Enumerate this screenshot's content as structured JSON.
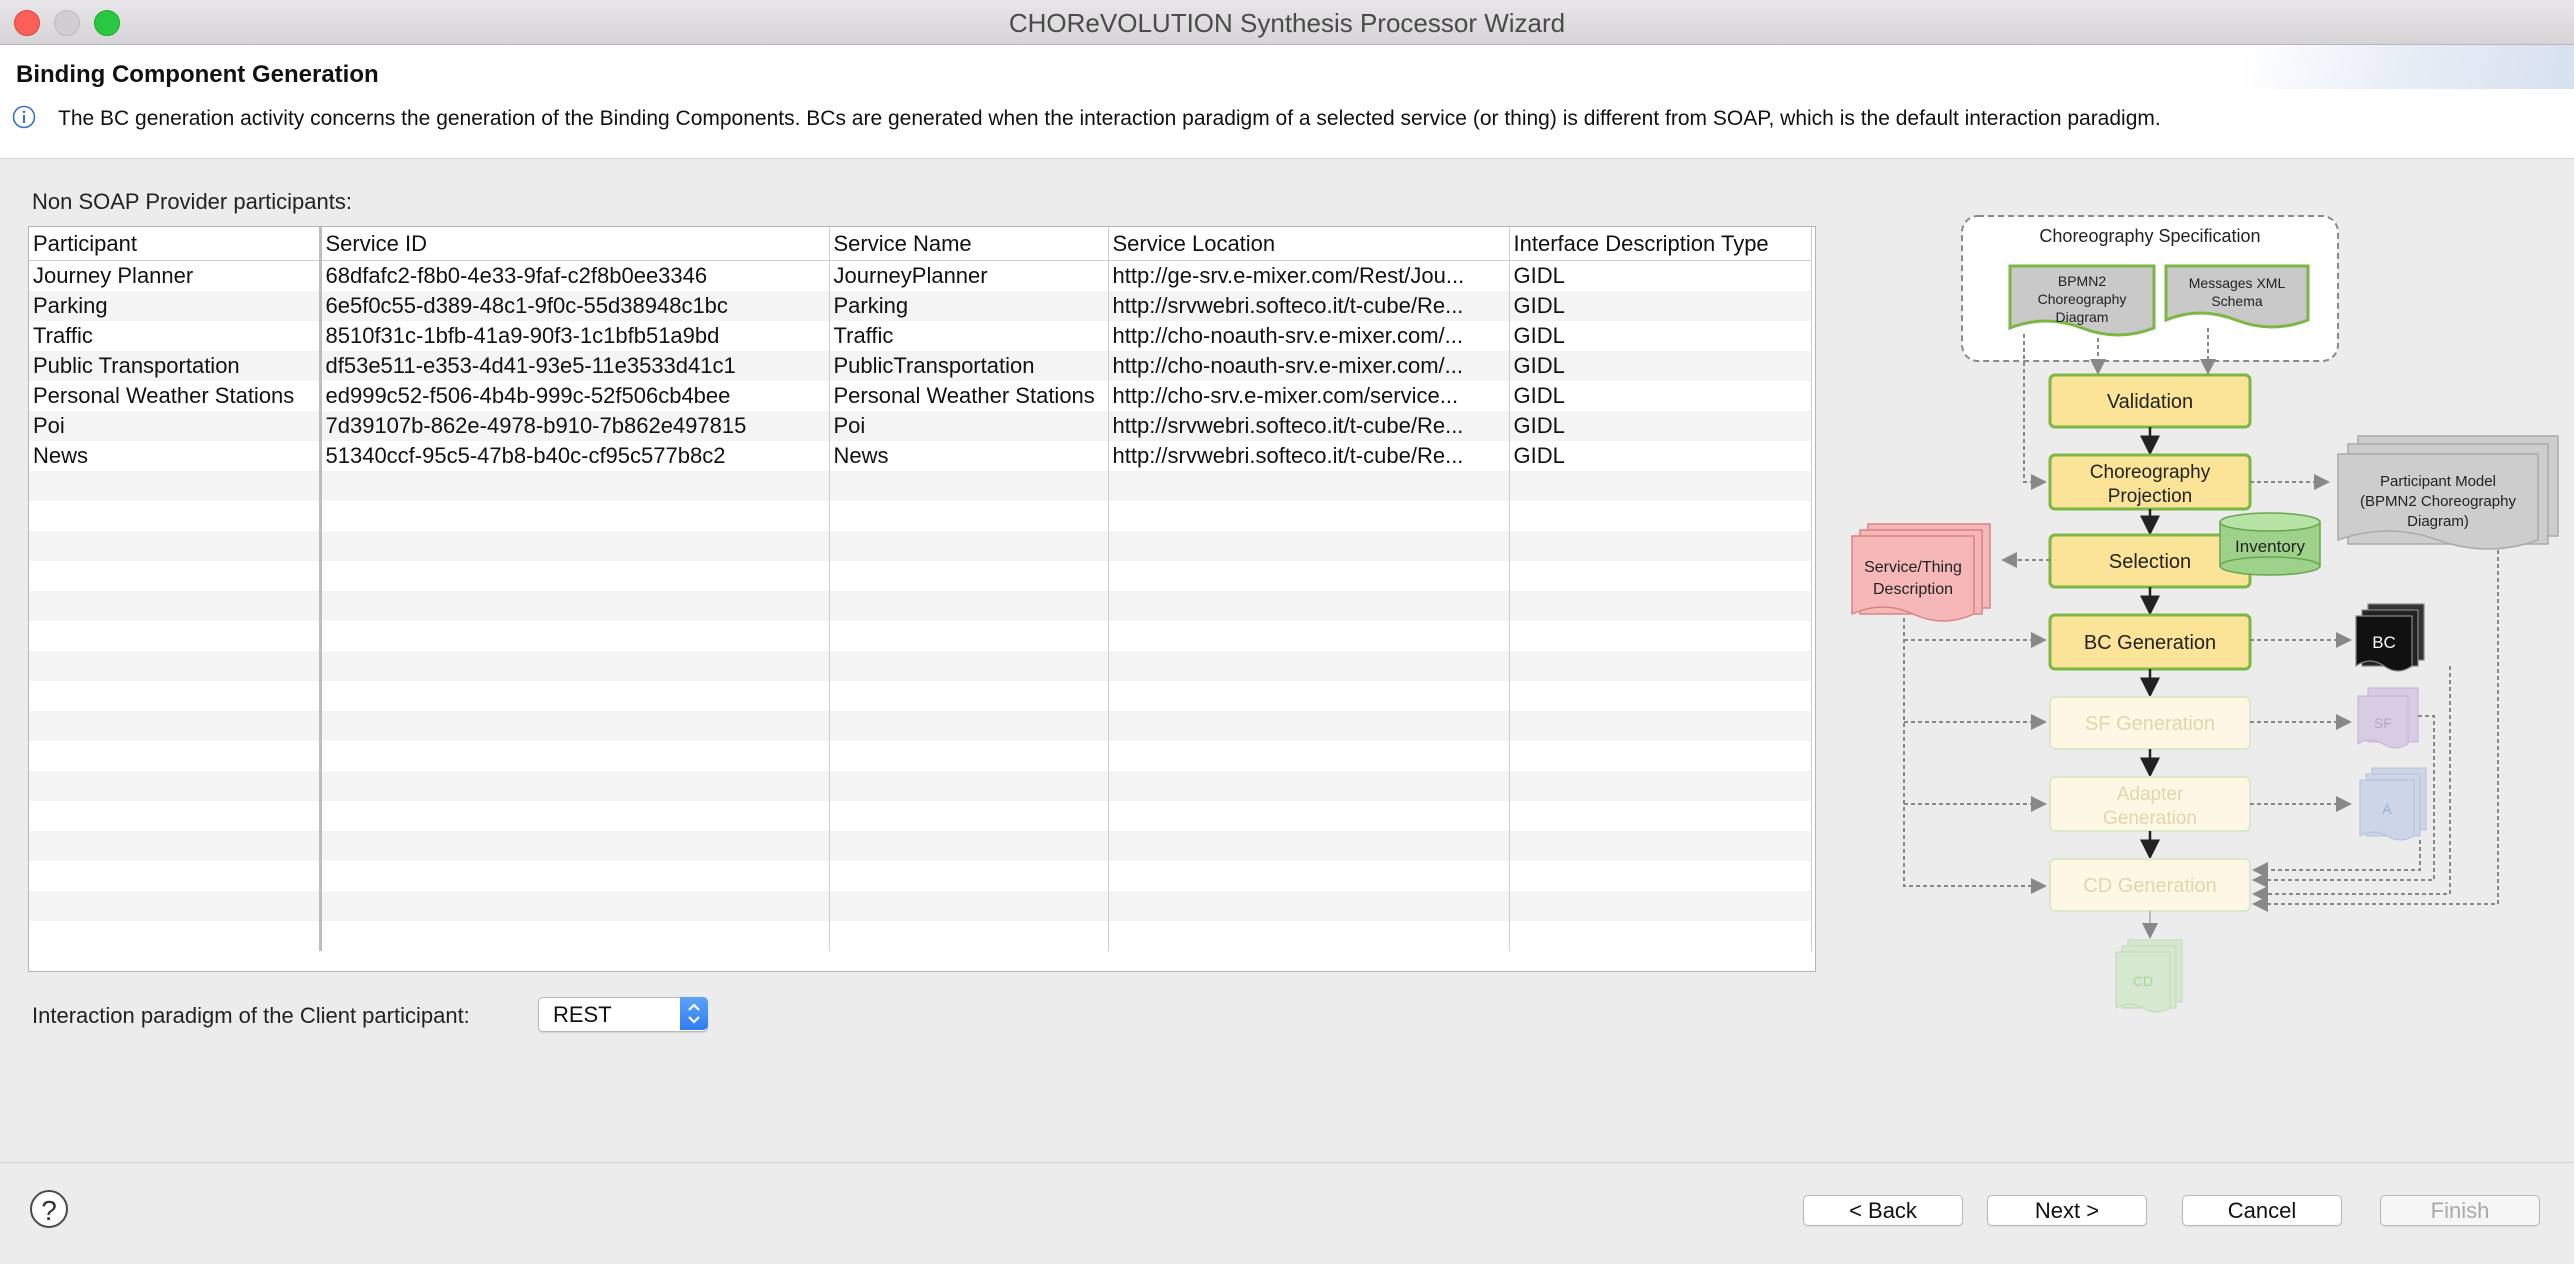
{
  "window": {
    "title": "CHOReVOLUTION Synthesis Processor Wizard"
  },
  "header": {
    "title": "Binding Component Generation",
    "description": "The BC generation activity concerns the generation of the Binding Components. BCs are generated when the interaction paradigm of a selected service (or thing) is different from SOAP, which is the default interaction paradigm."
  },
  "participants": {
    "label": "Non SOAP Provider participants:",
    "columns": [
      "Participant",
      "Service ID",
      "Service Name",
      "Service Location",
      "Interface Description Type"
    ],
    "rows": [
      [
        "Journey Planner",
        "68dfafc2-f8b0-4e33-9faf-c2f8b0ee3346",
        "JourneyPlanner",
        "http://ge-srv.e-mixer.com/Rest/Jou...",
        "GIDL"
      ],
      [
        "Parking",
        "6e5f0c55-d389-48c1-9f0c-55d38948c1bc",
        "Parking",
        "http://srvwebri.softeco.it/t-cube/Re...",
        "GIDL"
      ],
      [
        "Traffic",
        "8510f31c-1bfb-41a9-90f3-1c1bfb51a9bd",
        "Traffic",
        "http://cho-noauth-srv.e-mixer.com/...",
        "GIDL"
      ],
      [
        "Public Transportation",
        "df53e511-e353-4d41-93e5-11e3533d41c1",
        "PublicTransportation",
        "http://cho-noauth-srv.e-mixer.com/...",
        "GIDL"
      ],
      [
        "Personal Weather Stations",
        "ed999c52-f506-4b4b-999c-52f506cb4bee",
        "Personal Weather Stations",
        "http://cho-srv.e-mixer.com/service...",
        "GIDL"
      ],
      [
        "Poi",
        "7d39107b-862e-4978-b910-7b862e497815",
        "Poi",
        "http://srvwebri.softeco.it/t-cube/Re...",
        "GIDL"
      ],
      [
        "News",
        "51340ccf-95c5-47b8-b40c-cf95c577b8c2",
        "News",
        "http://srvwebri.softeco.it/t-cube/Re...",
        "GIDL"
      ]
    ]
  },
  "client_paradigm": {
    "label": "Interaction paradigm of the Client participant:",
    "value": "REST"
  },
  "diagram": {
    "spec_title": "Choreography Specification",
    "bpmn_doc": [
      "BPMN2",
      "Choreography",
      "Diagram"
    ],
    "xml_doc": [
      "Messages XML",
      "Schema"
    ],
    "steps": {
      "validation": "Validation",
      "projection": [
        "Choreography",
        "Projection"
      ],
      "selection": "Selection",
      "bc_generation": "BC Generation",
      "sf_generation": "SF Generation",
      "adapter_generation": [
        "Adapter",
        "Generation"
      ],
      "cd_generation": "CD Generation"
    },
    "inventory": "Inventory",
    "participant_model": [
      "Participant Model",
      "(BPMN2 Choreography",
      "Diagram)"
    ],
    "service_desc": [
      "Service/Thing",
      "Description"
    ],
    "bc_stack": "BC",
    "sf_stack": "SF",
    "a_stack": "A",
    "cd_stack": "CD"
  },
  "footer": {
    "help": "?",
    "back": "< Back",
    "next": "Next >",
    "cancel": "Cancel",
    "finish": "Finish"
  }
}
